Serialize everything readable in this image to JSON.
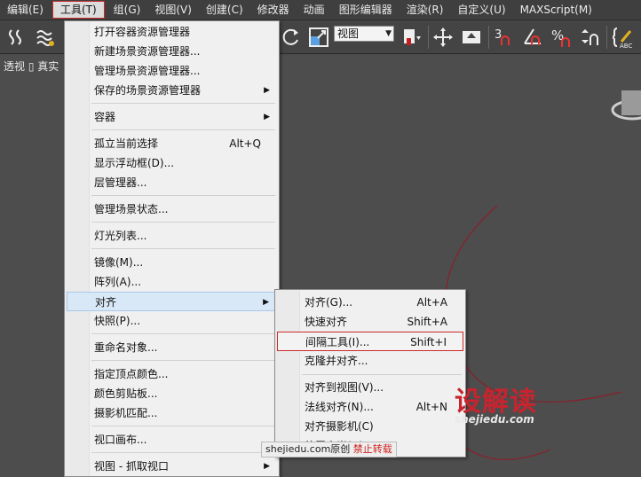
{
  "menubar": {
    "items": [
      {
        "label": "编辑(E)"
      },
      {
        "label": "工具(T)"
      },
      {
        "label": "组(G)"
      },
      {
        "label": "视图(V)"
      },
      {
        "label": "创建(C)"
      },
      {
        "label": "修改器"
      },
      {
        "label": "动画"
      },
      {
        "label": "图形编辑器"
      },
      {
        "label": "渲染(R)"
      },
      {
        "label": "自定义(U)"
      },
      {
        "label": "MAXScript(M)"
      }
    ],
    "active_index": 1
  },
  "toolbar": {
    "view_select": "视图",
    "icons": [
      "select-link-icon",
      "bind-spacewarp-icon",
      "rotate-icon",
      "scale-icon",
      "pivot-icon",
      "move-gizmo-icon",
      "snap-3-icon",
      "angle-snap-icon",
      "percent-snap-icon",
      "spinner-snap-icon",
      "edit-named-selection-icon"
    ]
  },
  "viewport": {
    "label": "透视 ▯ 真实"
  },
  "main_menu": {
    "items": [
      {
        "label": "打开容器资源管理器",
        "shortcut": "",
        "submenu": false
      },
      {
        "label": "新建场景资源管理器...",
        "shortcut": "",
        "submenu": false
      },
      {
        "label": "管理场景资源管理器...",
        "shortcut": "",
        "submenu": false
      },
      {
        "label": "保存的场景资源管理器",
        "shortcut": "",
        "submenu": true
      },
      {
        "label": "容器",
        "shortcut": "",
        "submenu": true
      },
      {
        "label": "孤立当前选择",
        "shortcut": "Alt+Q",
        "submenu": false
      },
      {
        "label": "显示浮动框(D)...",
        "shortcut": "",
        "submenu": false
      },
      {
        "label": "层管理器...",
        "shortcut": "",
        "submenu": false
      },
      {
        "label": "管理场景状态...",
        "shortcut": "",
        "submenu": false
      },
      {
        "label": "灯光列表...",
        "shortcut": "",
        "submenu": false
      },
      {
        "label": "镜像(M)...",
        "shortcut": "",
        "submenu": false
      },
      {
        "label": "阵列(A)...",
        "shortcut": "",
        "submenu": false
      },
      {
        "label": "对齐",
        "shortcut": "",
        "submenu": true
      },
      {
        "label": "快照(P)...",
        "shortcut": "",
        "submenu": false
      },
      {
        "label": "重命名对象...",
        "shortcut": "",
        "submenu": false
      },
      {
        "label": "指定顶点颜色...",
        "shortcut": "",
        "submenu": false
      },
      {
        "label": "颜色剪贴板...",
        "shortcut": "",
        "submenu": false
      },
      {
        "label": "摄影机匹配...",
        "shortcut": "",
        "submenu": false
      },
      {
        "label": "视口画布...",
        "shortcut": "",
        "submenu": false
      },
      {
        "label": "视图 - 抓取视口",
        "shortcut": "",
        "submenu": true
      }
    ]
  },
  "align_submenu": {
    "items": [
      {
        "label": "对齐(G)...",
        "shortcut": "Alt+A"
      },
      {
        "label": "快速对齐",
        "shortcut": "Shift+A"
      },
      {
        "label": "间隔工具(I)...",
        "shortcut": "Shift+I"
      },
      {
        "label": "克隆并对齐...",
        "shortcut": ""
      },
      {
        "label": "对齐到视图(V)...",
        "shortcut": ""
      },
      {
        "label": "法线对齐(N)...",
        "shortcut": "Alt+N"
      },
      {
        "label": "对齐摄影机(C)",
        "shortcut": ""
      },
      {
        "label": "放置高光(H)",
        "shortcut": ""
      }
    ]
  },
  "watermark": {
    "site": "shejiedu.com原创",
    "notice": "禁止转载",
    "logo": "设解读",
    "url": "shejiedu.com"
  },
  "colors": {
    "highlight_border": "#cc2a2a",
    "menu_highlight": "#d9e8f7",
    "viewport_bg": "#4d4d4d"
  }
}
